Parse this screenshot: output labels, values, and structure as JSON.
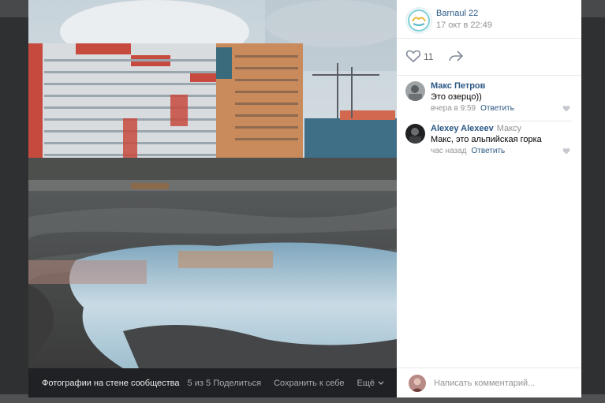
{
  "photo_viewer": {
    "footer": {
      "title": "Фотографии на стене сообщества",
      "counter": "5 из 5",
      "share_label": "Поделиться",
      "save_label": "Сохранить к себе",
      "more_label": "Ещё"
    }
  },
  "post": {
    "group_name": "Barnaul 22",
    "timestamp": "17 окт в 22:49",
    "likes_count": "11",
    "accent_color": "#2a5885"
  },
  "comments": [
    {
      "author": "Макс Петров",
      "reply_to": "",
      "text": "Это озерцо))",
      "time": "вчера в 9:59",
      "reply_label": "Ответить"
    },
    {
      "author": "Alexey Alexeev",
      "reply_to": "Максу",
      "text": "Макс, это альпийская горка",
      "time": "час назад",
      "reply_label": "Ответить"
    }
  ],
  "composer": {
    "placeholder": "Написать комментарий..."
  },
  "icons": [
    "heart-icon",
    "share-arrow-icon",
    "chevron-down-icon"
  ]
}
